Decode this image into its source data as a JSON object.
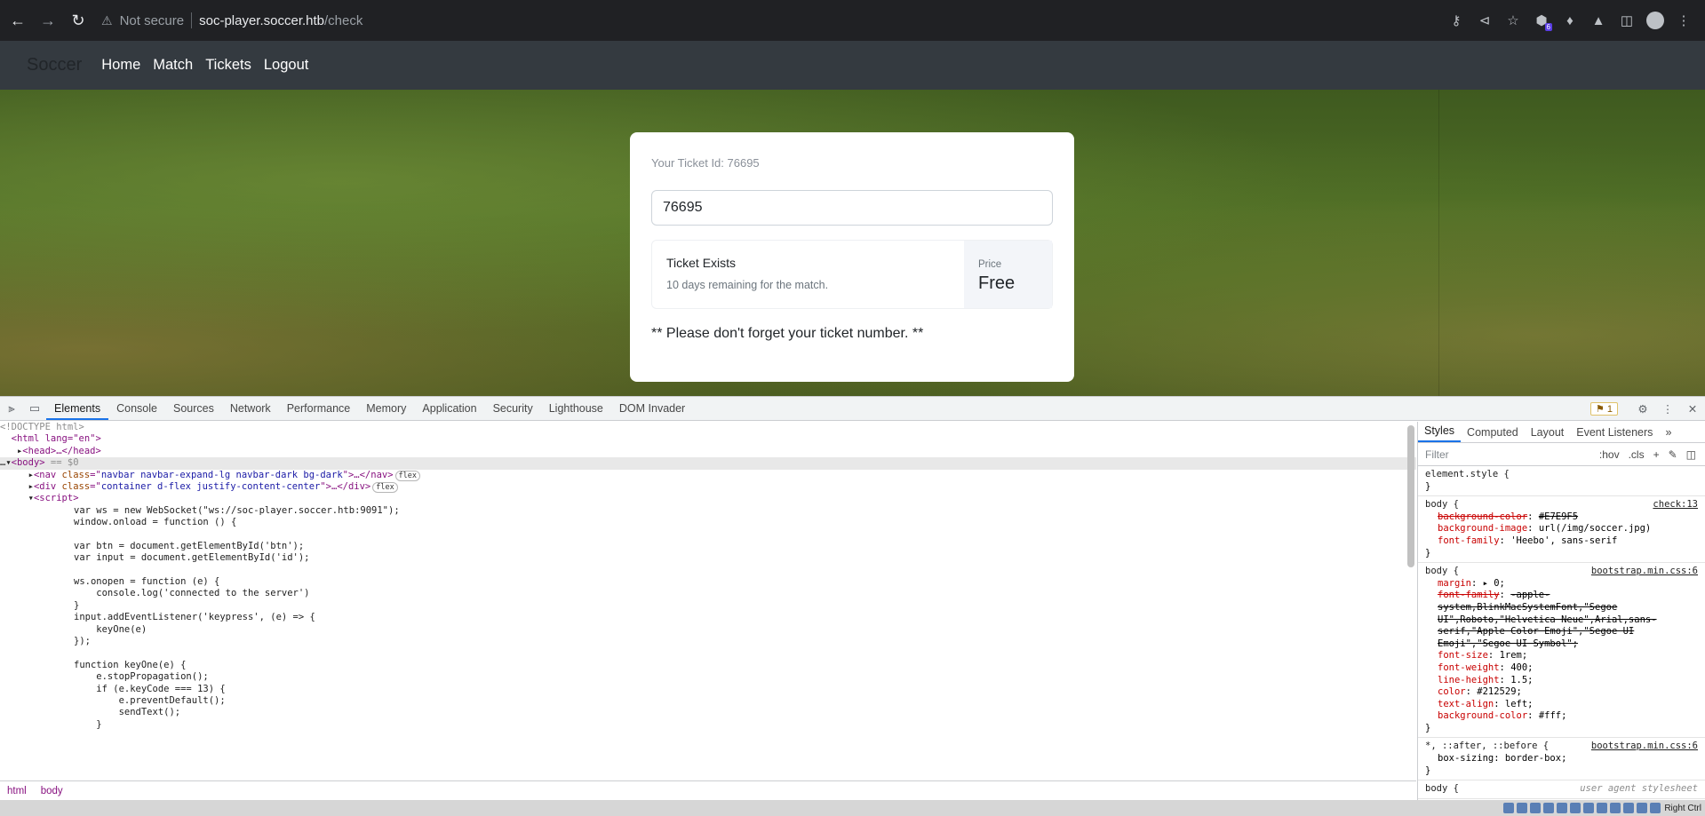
{
  "browser": {
    "not_secure": "Not secure",
    "url_host": "soc-player.soccer.htb",
    "url_path": "/check",
    "extension_badge": "6"
  },
  "site": {
    "brand": "Soccer",
    "nav": [
      "Home",
      "Match",
      "Tickets",
      "Logout"
    ]
  },
  "card": {
    "ticket_label": "Your Ticket Id: 76695",
    "input_value": "76695",
    "result_title": "Ticket Exists",
    "result_sub": "10 days remaining for the match.",
    "price_label": "Price",
    "price_value": "Free",
    "note": "** Please don't forget your ticket number. **"
  },
  "devtools": {
    "tabs": [
      "Elements",
      "Console",
      "Sources",
      "Network",
      "Performance",
      "Memory",
      "Application",
      "Security",
      "Lighthouse",
      "DOM Invader"
    ],
    "issues_count": "1",
    "dom": {
      "doctype": "<!DOCTYPE html>",
      "html_open": "<html lang=\"en\">",
      "head": "<head>…</head>",
      "body_suffix": " == $0",
      "nav": "navbar navbar-expand-lg navbar-dark bg-dark",
      "div": "container d-flex justify-content-center",
      "flex_badge": "flex",
      "script": [
        "var ws = new WebSocket(\"ws://soc-player.soccer.htb:9091\");",
        "window.onload = function () {",
        "",
        "var btn = document.getElementById('btn');",
        "var input = document.getElementById('id');",
        "",
        "ws.onopen = function (e) {",
        "    console.log('connected to the server')",
        "}",
        "input.addEventListener('keypress', (e) => {",
        "    keyOne(e)",
        "});",
        "",
        "function keyOne(e) {",
        "    e.stopPropagation();",
        "    if (e.keyCode === 13) {",
        "        e.preventDefault();",
        "        sendText();",
        "    }"
      ]
    },
    "breadcrumb": [
      "html",
      "body"
    ],
    "styles": {
      "tabs": [
        "Styles",
        "Computed",
        "Layout",
        "Event Listeners"
      ],
      "filter_placeholder": "Filter",
      "hov": ":hov",
      "cls": ".cls",
      "element_style": "element.style {",
      "rule1_selector": "body {",
      "rule1_source": "check:13",
      "rule1_props": [
        {
          "name": "background-color",
          "value": "#E7E9F5",
          "struck": true
        },
        {
          "name": "background-image",
          "value": "url(/img/soccer.jpg)",
          "struck": false
        },
        {
          "name": "font-family",
          "value": "'Heebo', sans-serif",
          "struck": false
        }
      ],
      "rule2_selector": "body {",
      "rule2_source": "bootstrap.min.css:6",
      "rule2_props": [
        {
          "name": "margin",
          "value": "▸ 0;",
          "struck": false
        },
        {
          "name": "font-family",
          "value": "-apple-system,BlinkMacSystemFont,\"Segoe UI\",Roboto,\"Helvetica Neue\",Arial,sans-serif,\"Apple Color Emoji\",\"Segoe UI Emoji\",\"Segoe UI Symbol\";",
          "struck": true
        },
        {
          "name": "font-size",
          "value": "1rem;",
          "struck": false
        },
        {
          "name": "font-weight",
          "value": "400;",
          "struck": false
        },
        {
          "name": "line-height",
          "value": "1.5;",
          "struck": false
        },
        {
          "name": "color",
          "value": "#212529;",
          "struck": false
        },
        {
          "name": "text-align",
          "value": "left;",
          "struck": false
        },
        {
          "name": "background-color",
          "value": "#fff;",
          "struck": false
        }
      ],
      "rule3_selector": "*, ::after, ::before {",
      "rule3_source": "bootstrap.min.css:6",
      "rule3_prop": "box-sizing: border-box;",
      "rule4_selector": "body {",
      "rule4_source": "user agent stylesheet"
    },
    "tray_text": "Right Ctrl"
  },
  "colors": {
    "navbar": "#343a40",
    "chrome": "#202124",
    "accent": "#1a73e8"
  }
}
